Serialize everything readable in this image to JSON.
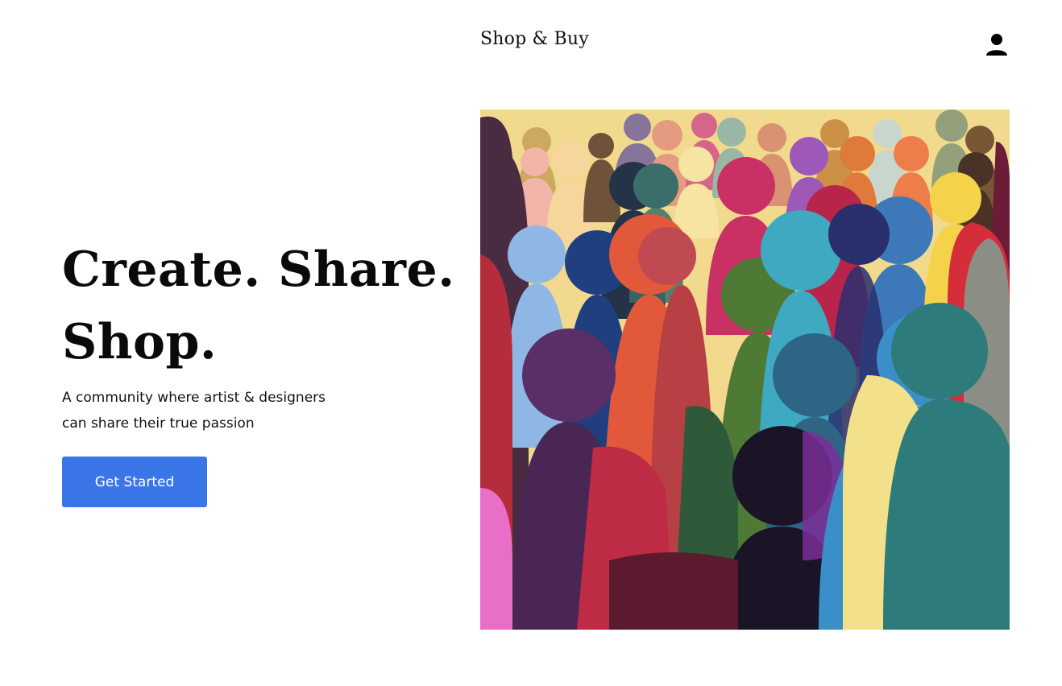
{
  "header": {
    "brand": "Shop & Buy",
    "user_icon": "user-icon"
  },
  "hero": {
    "title_line1": "Create. Share.",
    "title_line2": "Shop.",
    "subtitle_line1": "A community where artist & designers",
    "subtitle_line2": "can share their true passion",
    "cta_label": "Get Started"
  },
  "colors": {
    "accent": "#3b76e8",
    "text": "#0a0a0a",
    "background": "#ffffff"
  }
}
